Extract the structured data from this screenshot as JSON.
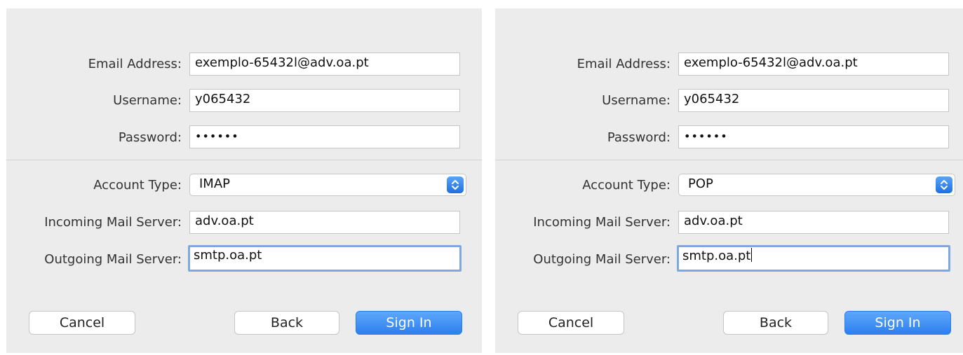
{
  "panels": [
    {
      "email_label": "Email Address:",
      "email_value": "exemplo-65432l@adv.oa.pt",
      "username_label": "Username:",
      "username_value": "y065432",
      "password_label": "Password:",
      "password_value": "••••••",
      "account_type_label": "Account Type:",
      "account_type_value": "IMAP",
      "incoming_label": "Incoming Mail Server:",
      "incoming_value": "adv.oa.pt",
      "outgoing_label": "Outgoing Mail Server:",
      "outgoing_value": "smtp.oa.pt",
      "cancel_label": "Cancel",
      "back_label": "Back",
      "signin_label": "Sign In"
    },
    {
      "email_label": "Email Address:",
      "email_value": "exemplo-65432l@adv.oa.pt",
      "username_label": "Username:",
      "username_value": "y065432",
      "password_label": "Password:",
      "password_value": "••••••",
      "account_type_label": "Account Type:",
      "account_type_value": "POP",
      "incoming_label": "Incoming Mail Server:",
      "incoming_value": "adv.oa.pt",
      "outgoing_label": "Outgoing Mail Server:",
      "outgoing_value": "smtp.oa.pt",
      "cancel_label": "Cancel",
      "back_label": "Back",
      "signin_label": "Sign In"
    }
  ],
  "icons": {
    "account_type_stepper": "chevron-up-down-icon"
  },
  "colors": {
    "accent": "#2d7ff0",
    "focus_ring": "#7fa8e3",
    "panel_bg": "#ececec"
  }
}
